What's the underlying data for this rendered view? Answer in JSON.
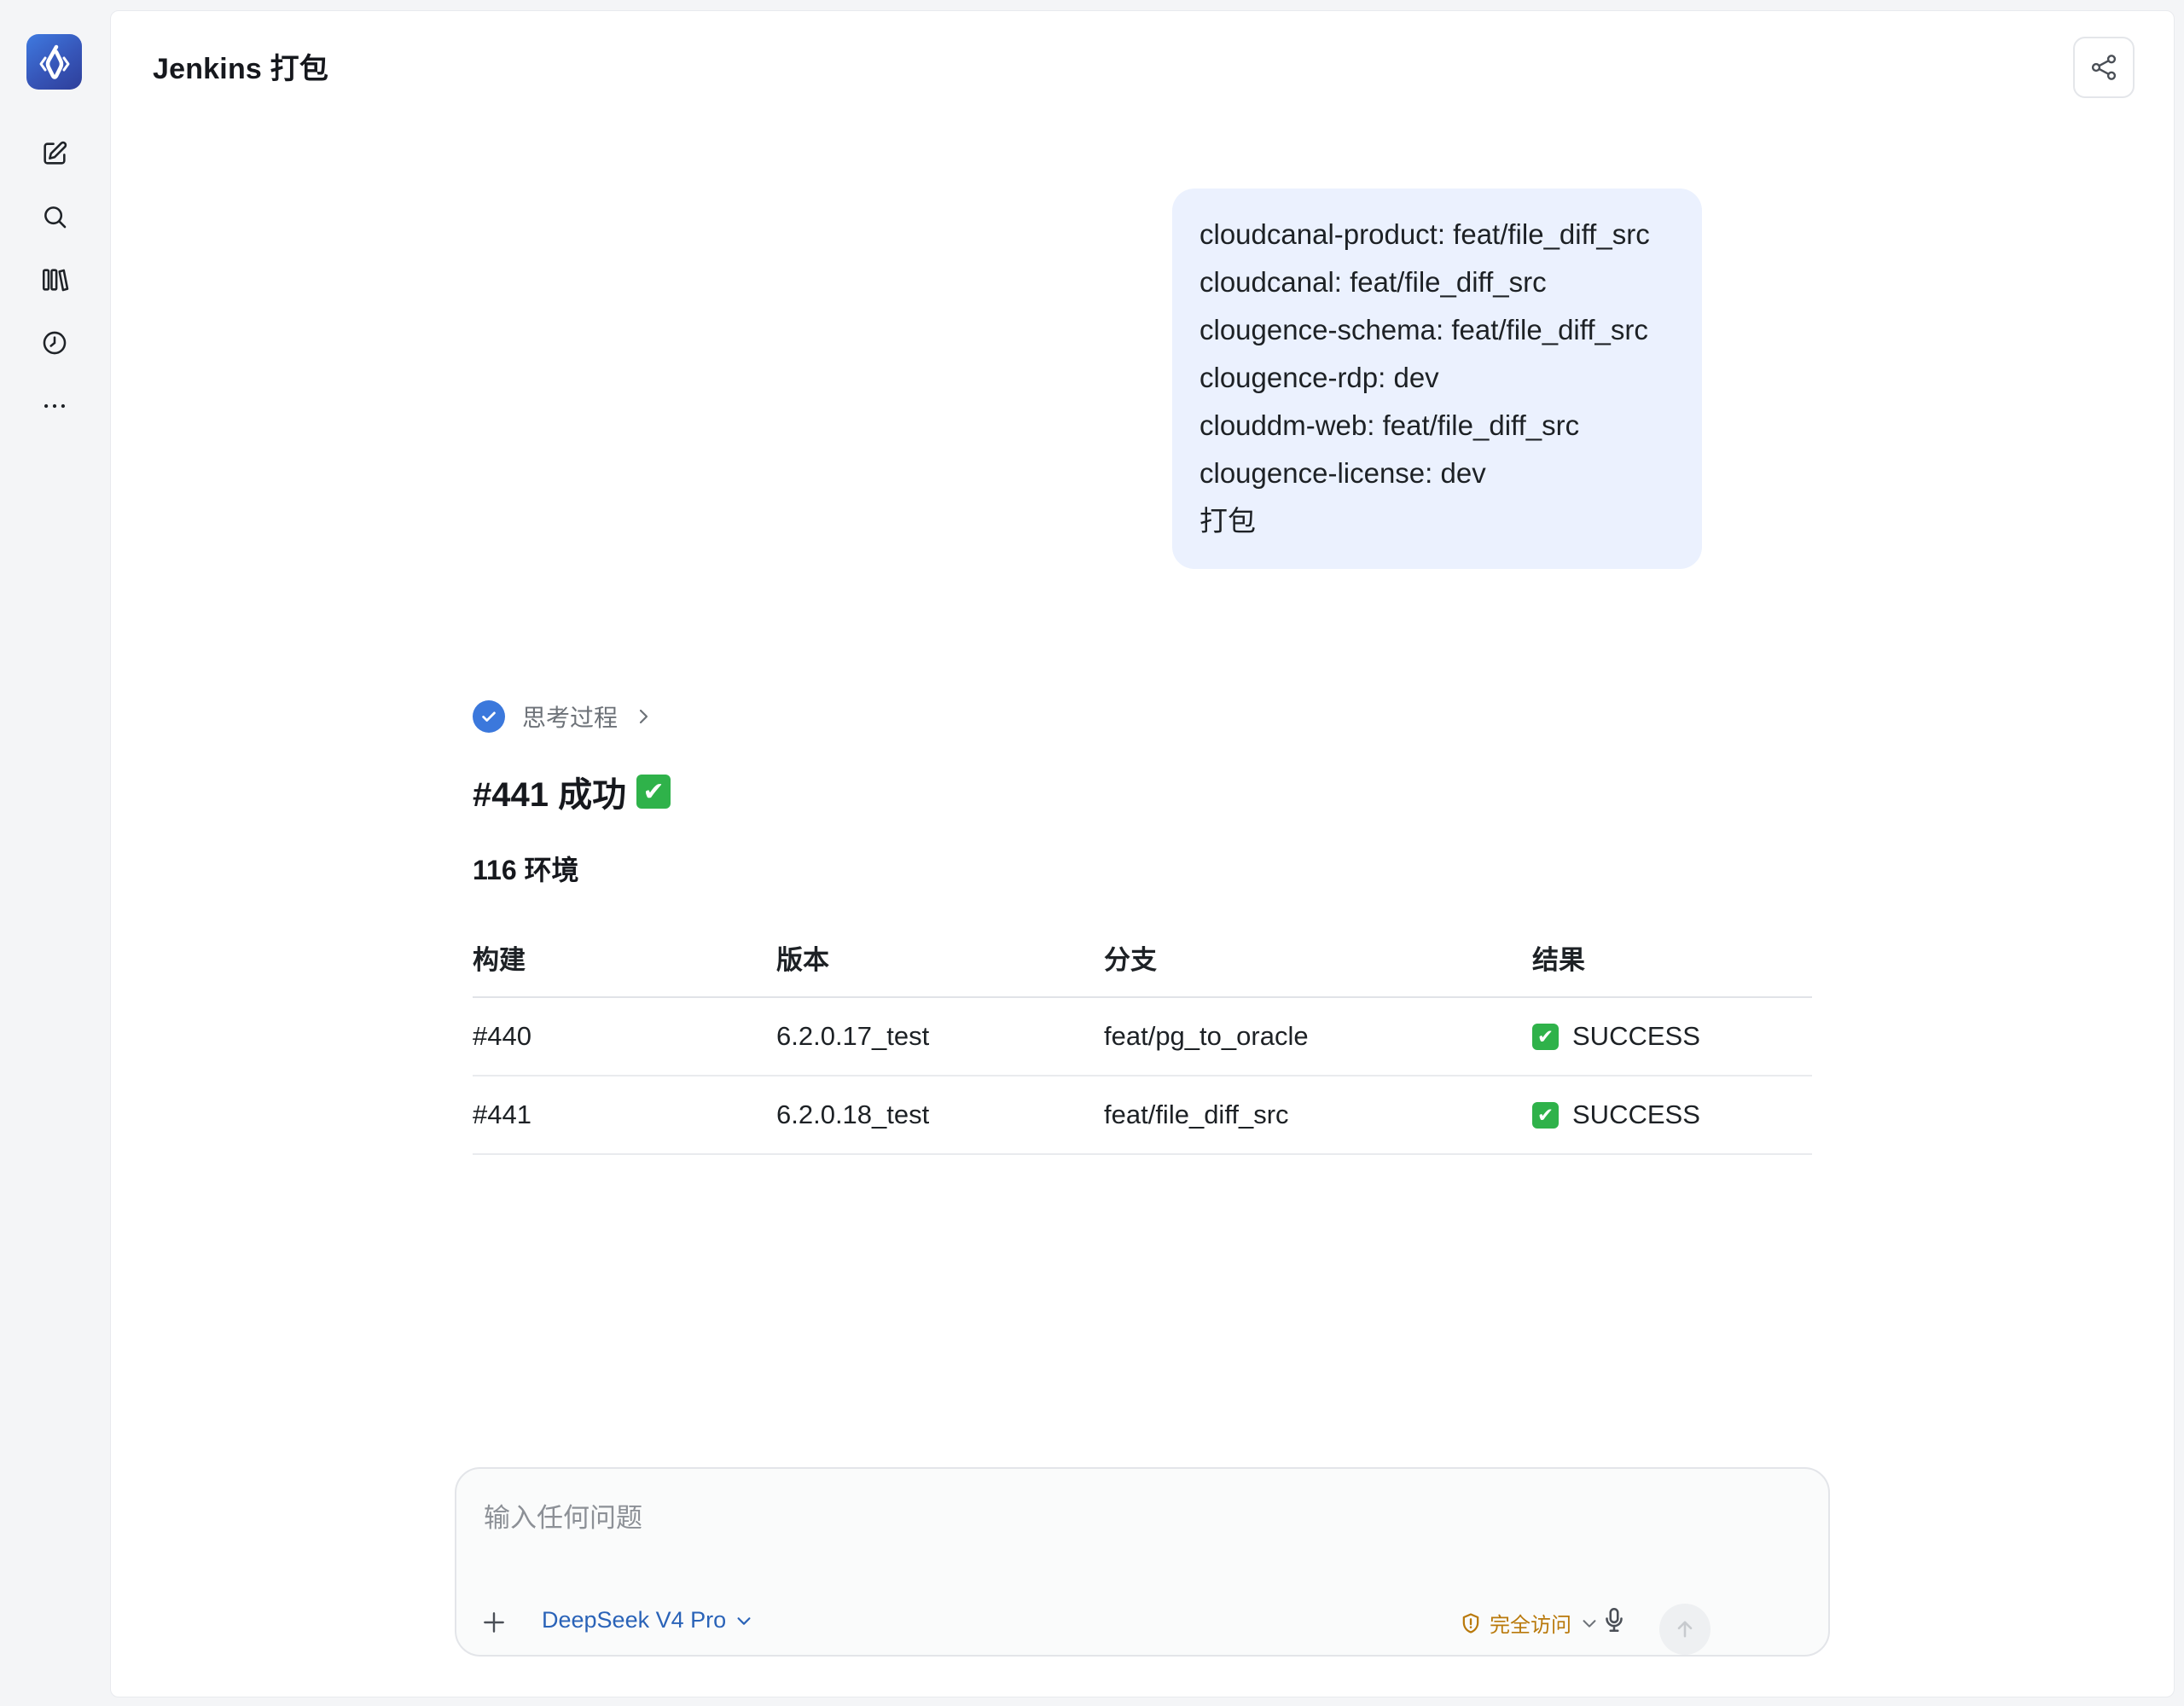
{
  "rail": {
    "logo_icon": "app-logo-icon",
    "items": [
      {
        "name": "new-chat",
        "icon": "edit-icon"
      },
      {
        "name": "search",
        "icon": "search-icon"
      },
      {
        "name": "library",
        "icon": "library-icon"
      },
      {
        "name": "history",
        "icon": "clock-icon"
      },
      {
        "name": "more",
        "icon": "more-icon"
      }
    ]
  },
  "header": {
    "title": "Jenkins 打包",
    "share_icon": "share-icon"
  },
  "user_message": {
    "lines": [
      "cloudcanal-product: feat/file_diff_src",
      "cloudcanal: feat/file_diff_src",
      "clougence-schema: feat/file_diff_src",
      "clougence-rdp: dev",
      "clouddm-web: feat/file_diff_src",
      "clougence-license: dev",
      "打包"
    ]
  },
  "assistant": {
    "thinking_label": "思考过程",
    "title": "#441 成功",
    "title_emoji": "✔",
    "env_heading": "116 环境",
    "table": {
      "headers": [
        "构建",
        "版本",
        "分支",
        "结果"
      ],
      "rows": [
        {
          "build": "#440",
          "version": "6.2.0.17_test",
          "branch": "feat/pg_to_oracle",
          "result_emoji": "✔",
          "result": "SUCCESS"
        },
        {
          "build": "#441",
          "version": "6.2.0.18_test",
          "branch": "feat/file_diff_src",
          "result_emoji": "✔",
          "result": "SUCCESS"
        }
      ]
    }
  },
  "composer": {
    "placeholder": "输入任何问题",
    "value": "",
    "model": "DeepSeek V4 Pro",
    "access": "完全访问"
  },
  "colors": {
    "accent": "#3b78dc",
    "bubble_bg": "#ebf1fe",
    "access_warning": "#b9790b",
    "success": "#2fb24a"
  }
}
